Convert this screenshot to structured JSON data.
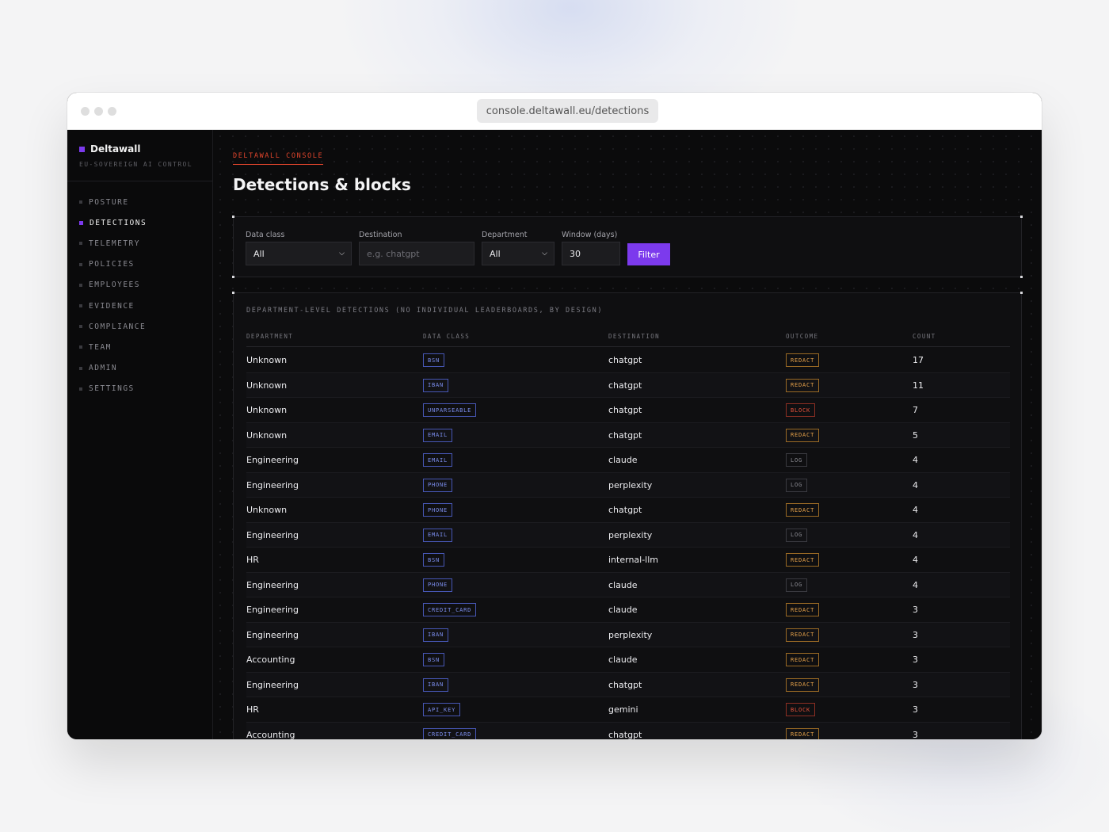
{
  "browser": {
    "url": "console.deltawall.eu/detections"
  },
  "sidebar": {
    "brand": "Deltawall",
    "subtitle": "EU-SOVEREIGN AI CONTROL",
    "items": [
      {
        "label": "POSTURE",
        "active": false
      },
      {
        "label": "DETECTIONS",
        "active": true
      },
      {
        "label": "TELEMETRY",
        "active": false
      },
      {
        "label": "POLICIES",
        "active": false
      },
      {
        "label": "EMPLOYEES",
        "active": false
      },
      {
        "label": "EVIDENCE",
        "active": false
      },
      {
        "label": "COMPLIANCE",
        "active": false
      },
      {
        "label": "TEAM",
        "active": false
      },
      {
        "label": "ADMIN",
        "active": false
      },
      {
        "label": "SETTINGS",
        "active": false
      }
    ]
  },
  "header": {
    "eyebrow": "DELTAWALL CONSOLE",
    "title": "Detections & blocks"
  },
  "filters": {
    "data_class": {
      "label": "Data class",
      "value": "All"
    },
    "destination": {
      "label": "Destination",
      "placeholder": "e.g. chatgpt",
      "value": ""
    },
    "department": {
      "label": "Department",
      "value": "All"
    },
    "window": {
      "label": "Window (days)",
      "value": "30"
    },
    "button": "Filter"
  },
  "table": {
    "caption": "DEPARTMENT-LEVEL DETECTIONS (NO INDIVIDUAL LEADERBOARDS, BY DESIGN)",
    "columns": [
      "DEPARTMENT",
      "DATA CLASS",
      "DESTINATION",
      "OUTCOME",
      "COUNT"
    ],
    "rows": [
      {
        "department": "Unknown",
        "data_class": "BSN",
        "destination": "chatgpt",
        "outcome": "REDACT",
        "count": "17"
      },
      {
        "department": "Unknown",
        "data_class": "IBAN",
        "destination": "chatgpt",
        "outcome": "REDACT",
        "count": "11"
      },
      {
        "department": "Unknown",
        "data_class": "UNPARSEABLE",
        "destination": "chatgpt",
        "outcome": "BLOCK",
        "count": "7"
      },
      {
        "department": "Unknown",
        "data_class": "EMAIL",
        "destination": "chatgpt",
        "outcome": "REDACT",
        "count": "5"
      },
      {
        "department": "Engineering",
        "data_class": "EMAIL",
        "destination": "claude",
        "outcome": "LOG",
        "count": "4"
      },
      {
        "department": "Engineering",
        "data_class": "PHONE",
        "destination": "perplexity",
        "outcome": "LOG",
        "count": "4"
      },
      {
        "department": "Unknown",
        "data_class": "PHONE",
        "destination": "chatgpt",
        "outcome": "REDACT",
        "count": "4"
      },
      {
        "department": "Engineering",
        "data_class": "EMAIL",
        "destination": "perplexity",
        "outcome": "LOG",
        "count": "4"
      },
      {
        "department": "HR",
        "data_class": "BSN",
        "destination": "internal-llm",
        "outcome": "REDACT",
        "count": "4"
      },
      {
        "department": "Engineering",
        "data_class": "PHONE",
        "destination": "claude",
        "outcome": "LOG",
        "count": "4"
      },
      {
        "department": "Engineering",
        "data_class": "CREDIT_CARD",
        "destination": "claude",
        "outcome": "REDACT",
        "count": "3"
      },
      {
        "department": "Engineering",
        "data_class": "IBAN",
        "destination": "perplexity",
        "outcome": "REDACT",
        "count": "3"
      },
      {
        "department": "Accounting",
        "data_class": "BSN",
        "destination": "claude",
        "outcome": "REDACT",
        "count": "3"
      },
      {
        "department": "Engineering",
        "data_class": "IBAN",
        "destination": "chatgpt",
        "outcome": "REDACT",
        "count": "3"
      },
      {
        "department": "HR",
        "data_class": "API_KEY",
        "destination": "gemini",
        "outcome": "BLOCK",
        "count": "3"
      },
      {
        "department": "Accounting",
        "data_class": "CREDIT_CARD",
        "destination": "chatgpt",
        "outcome": "REDACT",
        "count": "3"
      }
    ]
  },
  "colors": {
    "accent": "#7c3aed",
    "eyebrow": "#e2452c",
    "redact": "#e6a24a",
    "block": "#e5523c",
    "data_class": "#7d8ff0"
  }
}
